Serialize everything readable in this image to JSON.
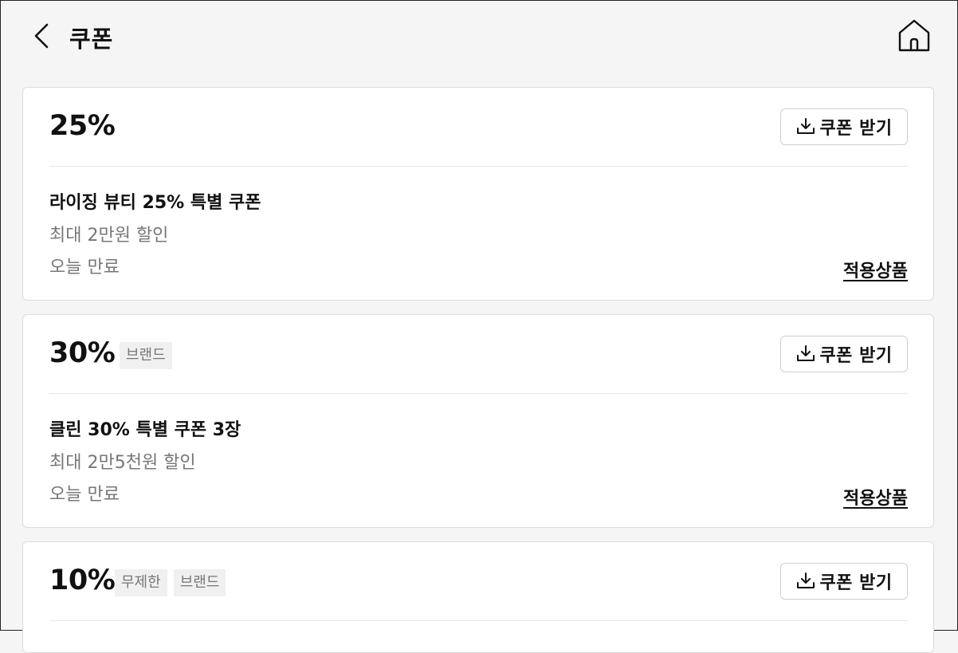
{
  "header": {
    "title": "쿠폰"
  },
  "coupons": [
    {
      "percent": "25%",
      "tags": [],
      "download_label": "쿠폰 받기",
      "name": "라이징 뷰티 25% 특별 쿠폰",
      "max_discount": "최대 2만원 할인",
      "expiry": "오늘 만료",
      "products_link": "적용상품"
    },
    {
      "percent": "30%",
      "tags": [
        "브랜드"
      ],
      "download_label": "쿠폰 받기",
      "name": "클린 30% 특별 쿠폰 3장",
      "max_discount": "최대 2만5천원 할인",
      "expiry": "오늘 만료",
      "products_link": "적용상품"
    },
    {
      "percent": "10%",
      "tags": [
        "무제한",
        "브랜드"
      ],
      "download_label": "쿠폰 받기",
      "name": "",
      "max_discount": "",
      "expiry": "",
      "products_link": ""
    }
  ],
  "icons": {
    "back": "chevron-left-icon",
    "home": "home-icon",
    "download": "download-icon"
  },
  "colors": {
    "background": "#f5f5f5",
    "card": "#ffffff",
    "text": "#111111",
    "muted_text": "#777777",
    "tag_background": "#f0f0f0",
    "border": "#dcdcdc"
  }
}
